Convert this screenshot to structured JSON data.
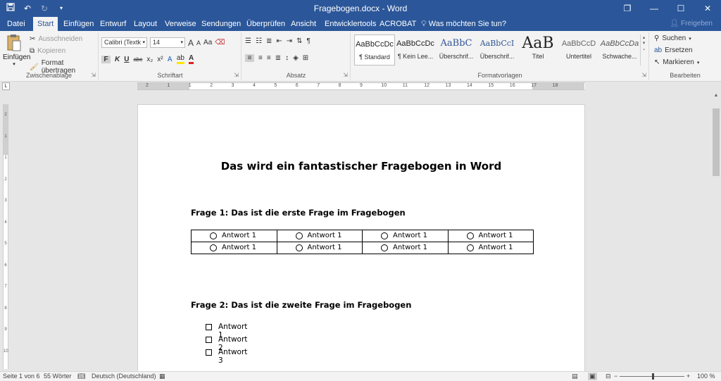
{
  "titlebar": {
    "title": "Fragebogen.docx - Word",
    "qat_icons": [
      "save-icon",
      "undo-icon",
      "redo-icon",
      "customize-icon"
    ],
    "restore_glyph": "❐",
    "minimize_glyph": "—",
    "maximize_glyph": "☐",
    "close_glyph": "✕"
  },
  "tabs": [
    {
      "label": "Datei",
      "active": false
    },
    {
      "label": "Start",
      "active": true
    },
    {
      "label": "Einfügen",
      "active": false
    },
    {
      "label": "Entwurf",
      "active": false
    },
    {
      "label": "Layout",
      "active": false
    },
    {
      "label": "Verweise",
      "active": false
    },
    {
      "label": "Sendungen",
      "active": false
    },
    {
      "label": "Überprüfen",
      "active": false
    },
    {
      "label": "Ansicht",
      "active": false
    },
    {
      "label": "Entwicklertools",
      "active": false
    },
    {
      "label": "ACROBAT",
      "active": false
    }
  ],
  "tellme": "Was möchten Sie tun?",
  "share": "Freigeben",
  "ribbon": {
    "clipboard": {
      "label": "Zwischenablage",
      "paste": "Einfügen",
      "cut": "Ausschneiden",
      "copy": "Kopieren",
      "format_painter": "Format übertragen"
    },
    "font": {
      "label": "Schriftart",
      "font_name": "Calibri (Textk",
      "font_size": "14",
      "bold": "F",
      "italic": "K",
      "underline": "U",
      "strike": "abc",
      "subscript": "x₂",
      "superscript": "x²",
      "grow": "A",
      "shrink": "A",
      "case": "Aa"
    },
    "paragraph": {
      "label": "Absatz"
    },
    "styles": {
      "label": "Formatvorlagen",
      "items": [
        {
          "sample": "AaBbCcDc",
          "name": "¶ Standard"
        },
        {
          "sample": "AaBbCcDc",
          "name": "¶ Kein Lee..."
        },
        {
          "sample": "AaBbC",
          "name": "Überschrif..."
        },
        {
          "sample": "AaBbCcI",
          "name": "Überschrif..."
        },
        {
          "sample": "AaB",
          "name": "Titel"
        },
        {
          "sample": "AaBbCcD",
          "name": "Untertitel"
        },
        {
          "sample": "AaBbCcDa",
          "name": "Schwache..."
        }
      ]
    },
    "editing": {
      "label": "Bearbeiten",
      "find": "Suchen",
      "replace": "Ersetzen",
      "select": "Markieren"
    }
  },
  "ruler": {
    "ticks": [
      "2",
      "1",
      "1",
      "2",
      "3",
      "4",
      "5",
      "6",
      "7",
      "8",
      "9",
      "10",
      "11",
      "12",
      "13",
      "14",
      "15",
      "16",
      "17",
      "18"
    ],
    "vticks": [
      "2",
      "1",
      "1",
      "2",
      "3",
      "4",
      "5",
      "6",
      "7",
      "8",
      "9",
      "10"
    ]
  },
  "document": {
    "title": "Das wird ein fantastischer Fragebogen in Word",
    "q1": "Frage 1: Das ist die erste Frage im Fragebogen",
    "q1_rows": [
      [
        "Antwort 1",
        "Antwort 1",
        "Antwort 1",
        "Antwort 1"
      ],
      [
        "Antwort 1",
        "Antwort 1",
        "Antwort 1",
        "Antwort 1"
      ]
    ],
    "q2": "Frage 2: Das ist die zweite Frage im Fragebogen",
    "q2_items": [
      "Antwort 1",
      "Antwort 2",
      "Antwort 3"
    ]
  },
  "status": {
    "page": "Seite 1 von 6",
    "words": "55 Wörter",
    "language": "Deutsch (Deutschland)",
    "zoom": "100 %",
    "zoom_minus": "−",
    "zoom_plus": "+"
  }
}
